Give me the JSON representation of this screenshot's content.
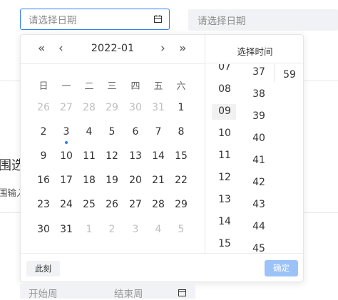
{
  "inputs": {
    "date_placeholder_1": "请选择日期",
    "date_placeholder_2": "请选择日期",
    "range_start_placeholder": "开始周",
    "range_end_placeholder": "结束周"
  },
  "background": {
    "heading_fragment": "围选",
    "subtext_fragment": "围输入"
  },
  "calendar": {
    "prev_year": "«",
    "prev_month": "‹",
    "next_month": "›",
    "next_year": "»",
    "month_title": "2022-01",
    "weekdays": [
      "日",
      "一",
      "二",
      "三",
      "四",
      "五",
      "六"
    ],
    "weeks": [
      [
        {
          "d": "26",
          "m": true
        },
        {
          "d": "27",
          "m": true
        },
        {
          "d": "28",
          "m": true
        },
        {
          "d": "29",
          "m": true
        },
        {
          "d": "30",
          "m": true
        },
        {
          "d": "31",
          "m": true
        },
        {
          "d": "1",
          "m": false
        }
      ],
      [
        {
          "d": "2",
          "m": false
        },
        {
          "d": "3",
          "m": false,
          "today": true
        },
        {
          "d": "4",
          "m": false
        },
        {
          "d": "5",
          "m": false
        },
        {
          "d": "6",
          "m": false
        },
        {
          "d": "7",
          "m": false
        },
        {
          "d": "8",
          "m": false
        }
      ],
      [
        {
          "d": "9",
          "m": false
        },
        {
          "d": "10",
          "m": false
        },
        {
          "d": "11",
          "m": false
        },
        {
          "d": "12",
          "m": false
        },
        {
          "d": "13",
          "m": false
        },
        {
          "d": "14",
          "m": false
        },
        {
          "d": "15",
          "m": false
        }
      ],
      [
        {
          "d": "16",
          "m": false
        },
        {
          "d": "17",
          "m": false
        },
        {
          "d": "18",
          "m": false
        },
        {
          "d": "19",
          "m": false
        },
        {
          "d": "20",
          "m": false
        },
        {
          "d": "21",
          "m": false
        },
        {
          "d": "22",
          "m": false
        }
      ],
      [
        {
          "d": "23",
          "m": false
        },
        {
          "d": "24",
          "m": false
        },
        {
          "d": "25",
          "m": false
        },
        {
          "d": "26",
          "m": false
        },
        {
          "d": "27",
          "m": false
        },
        {
          "d": "28",
          "m": false
        },
        {
          "d": "29",
          "m": false
        }
      ],
      [
        {
          "d": "30",
          "m": false
        },
        {
          "d": "31",
          "m": false
        },
        {
          "d": "1",
          "m": true
        },
        {
          "d": "2",
          "m": true
        },
        {
          "d": "3",
          "m": true
        },
        {
          "d": "4",
          "m": true
        },
        {
          "d": "5",
          "m": true
        }
      ]
    ]
  },
  "time_picker": {
    "title": "选择时间",
    "hours": [
      "07",
      "08",
      "09",
      "10",
      "11",
      "12",
      "13",
      "14",
      "15"
    ],
    "selected_hour": "09",
    "minutes": [
      "37",
      "38",
      "39",
      "40",
      "41",
      "42",
      "43",
      "44",
      "45"
    ],
    "seconds": [
      "59"
    ]
  },
  "footer": {
    "now_label": "此刻",
    "ok_label": "确定"
  },
  "colors": {
    "accent": "#2f7df6",
    "ok_disabled": "#9cc3f8"
  }
}
